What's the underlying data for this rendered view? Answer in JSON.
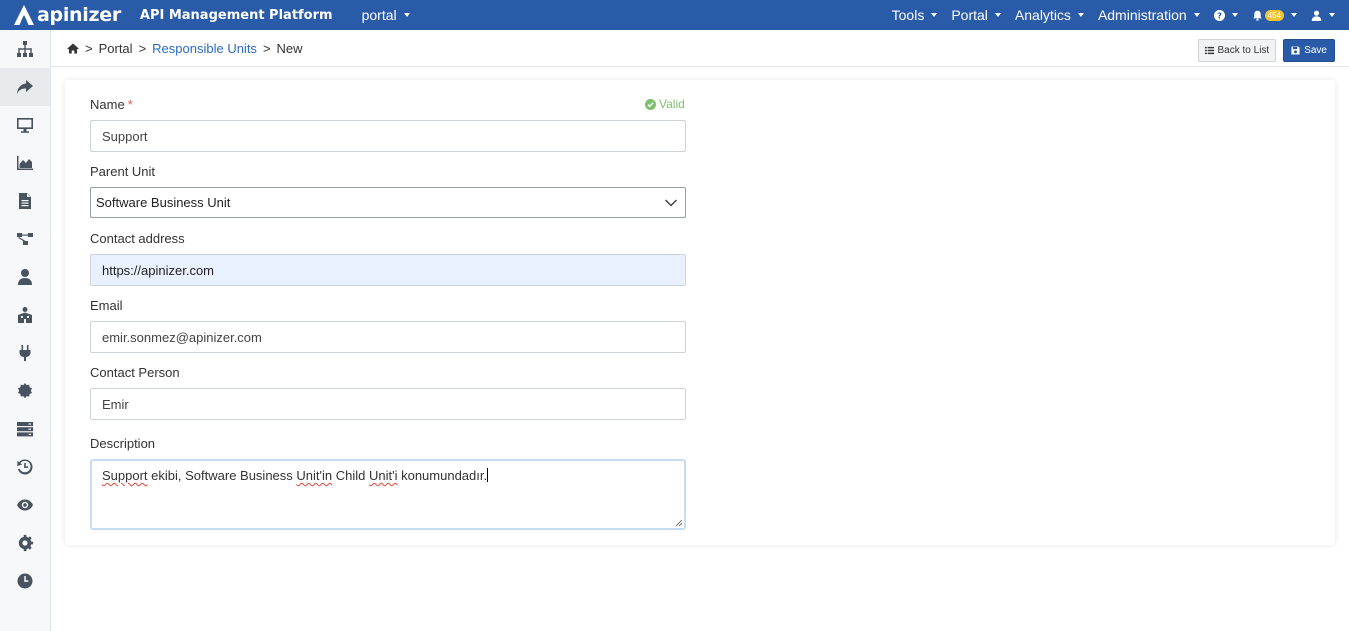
{
  "header": {
    "logo_text": "apinizer",
    "platform_title": "API Management Platform",
    "environment": "portal",
    "nav": [
      "Tools",
      "Portal",
      "Analytics",
      "Administration"
    ],
    "notification_count": "454"
  },
  "breadcrumb": {
    "home_icon": "home-icon",
    "items": [
      "Portal",
      "Responsible Units",
      "New"
    ],
    "separator": ">"
  },
  "toolbar": {
    "back_label": "Back to List",
    "save_label": "Save"
  },
  "sidebar": {
    "icons": [
      "sitemap-icon",
      "share-arrow-icon",
      "desktop-icon",
      "area-chart-icon",
      "document-icon",
      "flow-icon",
      "user-icon",
      "users-building-icon",
      "plug-icon",
      "gear-badge-icon",
      "server-icon",
      "history-icon",
      "eye-icon",
      "settings-icon",
      "clock-icon"
    ],
    "active_index": 1
  },
  "form": {
    "name_label": "Name",
    "name_required": "*",
    "name_status": "Valid",
    "name_value": "Support",
    "parent_label": "Parent Unit",
    "parent_value": "Software Business Unit",
    "contact_label": "Contact address",
    "contact_value": "https://apinizer.com",
    "email_label": "Email",
    "email_value": "emir.sonmez@apinizer.com",
    "person_label": "Contact Person",
    "person_value": "Emir",
    "description_label": "Description",
    "description_parts": [
      "Support",
      " ekibi, Software Business ",
      "Unit'in",
      " Child ",
      "Unit'i",
      " konumundadır."
    ]
  },
  "colors": {
    "brand": "#2a5ba8",
    "valid": "#7dc06c",
    "link": "#2a6cc4"
  }
}
